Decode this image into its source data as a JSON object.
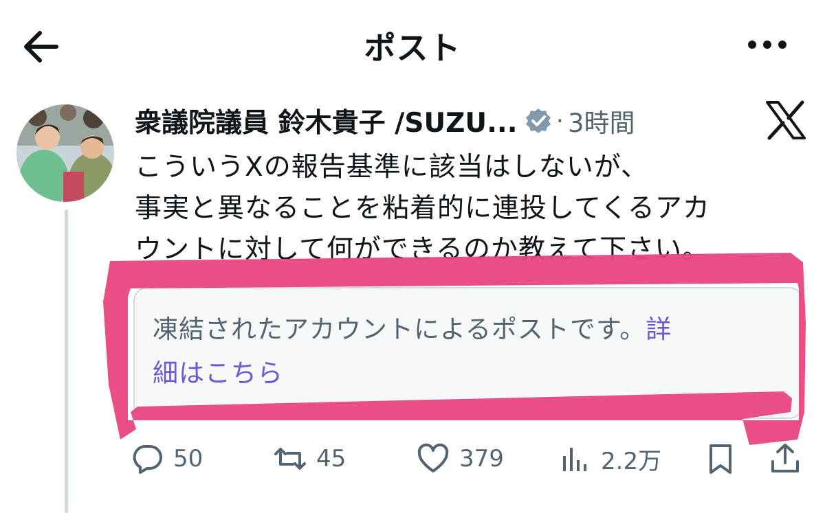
{
  "header": {
    "title": "ポスト",
    "back_icon": "back-arrow-icon",
    "more_icon": "more-dots-icon"
  },
  "post": {
    "author_name": "衆議院議員 鈴木貴子 /SUZU...",
    "verified_icon": "verified-badge-icon",
    "separator": "·",
    "time": "3時間",
    "text_lines": [
      "こういうXの報告基準に該当はしないが、",
      "事実と異なることを粘着的に連投してくるアカ",
      "ウントに対して何ができるのか教えて下さい。"
    ],
    "notice": {
      "line1": "凍結されたアカウントによるポストです。",
      "link_part1": "詳",
      "link_part2": "細はこちら"
    }
  },
  "actions": {
    "replies": "50",
    "reposts": "45",
    "likes": "379",
    "views": "2.2万"
  },
  "colors": {
    "text": "#0f1419",
    "secondary": "#536471",
    "link": "#6e57d6",
    "highlight": "#e8457f",
    "notice_bg": "#f7f9f9",
    "border": "#cfd9de"
  }
}
